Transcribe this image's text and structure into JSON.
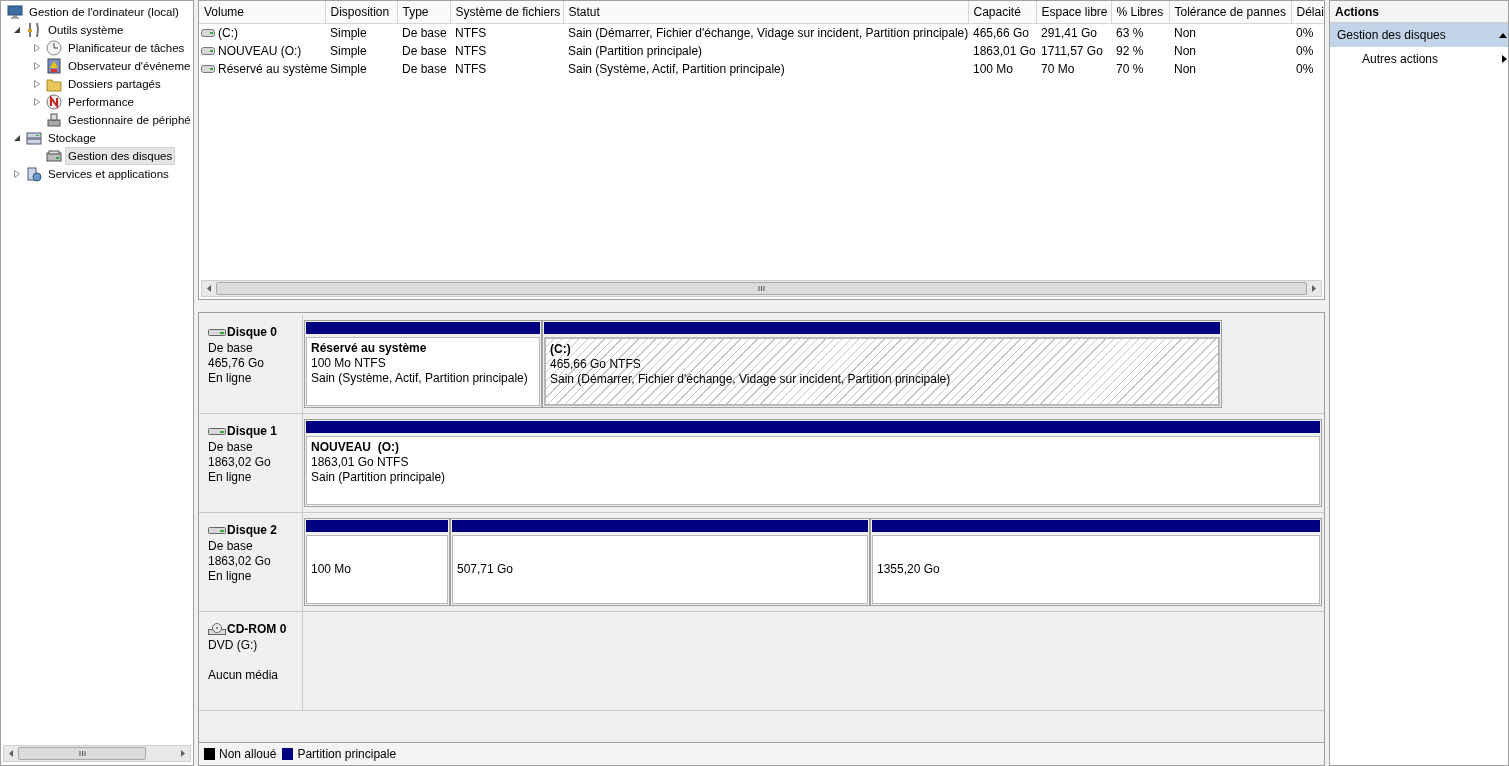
{
  "tree": [
    {
      "label": "Gestion de l'ordinateur (local)",
      "selected": false,
      "children": [
        {
          "label": "Outils système",
          "expanded": true,
          "selected": false,
          "children": [
            {
              "label": "Planificateur de tâches",
              "expanded": false,
              "selected": false
            },
            {
              "label": "Observateur d'événeme",
              "expanded": false,
              "selected": false
            },
            {
              "label": "Dossiers partagés",
              "expanded": false,
              "selected": false
            },
            {
              "label": "Performance",
              "expanded": false,
              "selected": false
            },
            {
              "label": "Gestionnaire de périphé",
              "selected": false
            }
          ]
        },
        {
          "label": "Stockage",
          "expanded": true,
          "selected": false,
          "children": [
            {
              "label": "Gestion des disques",
              "selected": true
            }
          ]
        },
        {
          "label": "Services et applications",
          "expanded": false,
          "selected": false
        }
      ]
    }
  ],
  "table": {
    "columns": [
      "Volume",
      "Disposition",
      "Type",
      "Système de fichiers",
      "Statut",
      "Capacité",
      "Espace libre",
      "% Libres",
      "Tolérance de pannes",
      "Délai"
    ],
    "rows": [
      [
        "(C:)",
        "Simple",
        "De base",
        "NTFS",
        "Sain (Démarrer, Fichier d'échange, Vidage sur incident, Partition principale)",
        "465,66 Go",
        "291,41 Go",
        "63 %",
        "Non",
        "0%"
      ],
      [
        "NOUVEAU (O:)",
        "Simple",
        "De base",
        "NTFS",
        "Sain (Partition principale)",
        "1863,01 Go",
        "1711,57 Go",
        "92 %",
        "Non",
        "0%"
      ],
      [
        "Réservé au système",
        "Simple",
        "De base",
        "NTFS",
        "Sain (Système, Actif, Partition principale)",
        "100 Mo",
        "70 Mo",
        "70 %",
        "Non",
        "0%"
      ]
    ]
  },
  "disks": [
    {
      "kind": "disk",
      "name": "Disque 0",
      "details": [
        "De base",
        "465,76 Go"
      ],
      "status": "En ligne",
      "partitions": [
        {
          "title": "Réservé au système",
          "lines": [
            "100 Mo NTFS",
            "Sain (Système, Actif, Partition principale)"
          ],
          "selected": false
        },
        {
          "title": "(C:)",
          "lines": [
            "465,66 Go NTFS",
            "Sain (Démarrer, Fichier d'échange, Vidage sur incident, Partition principale)"
          ],
          "selected": true
        }
      ]
    },
    {
      "kind": "disk",
      "name": "Disque 1",
      "details": [
        "De base",
        "1863,02 Go"
      ],
      "status": "En ligne",
      "partitions": [
        {
          "title": "NOUVEAU  (O:)",
          "lines": [
            "1863,01 Go NTFS",
            "Sain (Partition principale)"
          ],
          "selected": false
        }
      ]
    },
    {
      "kind": "disk",
      "name": "Disque 2",
      "details": [
        "De base",
        "1863,02 Go"
      ],
      "status": "En ligne",
      "partitions": [
        {
          "lines": [
            "100 Mo"
          ],
          "selected": false
        },
        {
          "lines": [
            "507,71 Go"
          ],
          "selected": false
        },
        {
          "lines": [
            "1355,20 Go"
          ],
          "selected": false
        }
      ]
    },
    {
      "kind": "cdrom",
      "name": "CD-ROM 0",
      "details": [
        "DVD (G:)"
      ],
      "status": "Aucun média"
    }
  ],
  "legend": [
    {
      "label": "Non alloué",
      "color": "#000000"
    },
    {
      "label": "Partition principale",
      "color": "#000080"
    }
  ],
  "actions": {
    "title": "Actions",
    "sections": [
      {
        "title": "Gestion des disques",
        "expanded": true,
        "items": [
          {
            "label": "Autres actions",
            "submenu": true
          }
        ]
      }
    ]
  }
}
